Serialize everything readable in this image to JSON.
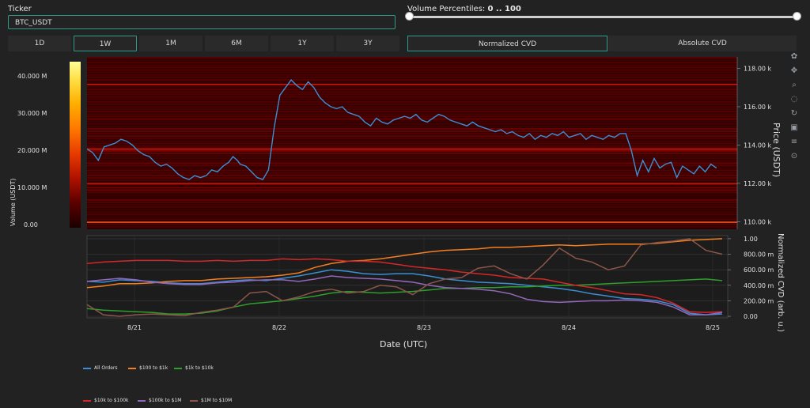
{
  "ticker": {
    "label": "Ticker",
    "value": "BTC_USDT"
  },
  "volume_percentiles": {
    "label": "Volume Percentiles:",
    "range_text": "0 .. 100",
    "low": 0,
    "high": 100
  },
  "timeframes": [
    {
      "label": "1D",
      "active": false
    },
    {
      "label": "1W",
      "active": true
    },
    {
      "label": "1M",
      "active": false
    },
    {
      "label": "6M",
      "active": false
    },
    {
      "label": "1Y",
      "active": false
    },
    {
      "label": "3Y",
      "active": false
    }
  ],
  "cvd_modes": [
    {
      "label": "Normalized CVD",
      "active": true
    },
    {
      "label": "Absolute CVD",
      "active": false
    }
  ],
  "toolbar_icons": [
    "plotly-logo-icon",
    "pan-icon",
    "zoom-icon",
    "lasso-icon",
    "reset-icon",
    "camera-icon",
    "compare-icon",
    "spike-icon"
  ],
  "colors": {
    "accent": "#2e9c88",
    "price_line": "#3a8fd6",
    "background": "#222222",
    "plot_bg": "#1a1a1a"
  },
  "chart_data": [
    {
      "type": "heatmap",
      "colorbar_label": "Volume (USDT)",
      "colorbar_ticks": [
        "40.000 M",
        "30.000 M",
        "20.000 M",
        "10.000 M",
        "0.00"
      ],
      "y_right_label": "Price (USDT)",
      "y_right_ticks": [
        "118.00 k",
        "116.00 k",
        "114.00 k",
        "112.00 k",
        "110.00 k"
      ],
      "ylim": [
        109.6,
        118.6
      ],
      "price_series": {
        "name": "Price",
        "x": [
          0,
          0.4,
          0.8,
          1.2,
          1.6,
          2.0,
          2.4,
          2.8,
          3.2,
          3.6,
          4.0,
          4.4,
          4.8,
          5.2,
          5.6,
          6.0,
          6.4,
          6.8,
          7.2,
          7.6,
          8.0,
          8.4,
          8.8,
          9.2,
          9.6,
          10.0,
          10.3,
          10.6,
          10.8,
          11.2,
          11.6,
          12.0,
          12.4,
          12.8,
          13.2,
          13.6,
          14.0,
          14.4,
          14.8,
          15.2,
          15.6,
          16.0,
          16.4,
          16.8,
          17.2,
          17.6,
          18.0,
          18.4,
          18.8,
          19.2,
          19.6,
          20.0,
          20.4,
          20.8,
          21.2,
          21.6,
          22.0,
          22.4,
          22.8,
          23.2,
          23.6,
          24.0,
          24.4,
          24.8,
          25.2,
          25.6,
          26.0,
          26.4,
          26.8,
          27.2,
          27.6,
          28.0,
          28.4,
          28.8,
          29.2,
          29.6,
          30.0,
          30.4,
          30.8,
          31.2,
          31.6,
          32.0,
          32.4,
          32.8,
          33.2,
          33.6,
          34.0,
          34.4,
          34.8,
          35.2,
          35.6,
          36.0,
          36.4,
          36.8,
          37.2,
          37.6,
          38.0,
          38.4,
          38.8,
          39.2,
          39.6,
          40.0,
          40.4,
          40.8,
          41.2,
          41.6,
          42.0,
          42.4,
          42.8,
          43.2,
          43.6,
          44.0,
          44.4,
          44.8
        ],
        "y": [
          113.8,
          113.6,
          113.2,
          113.9,
          114.0,
          114.1,
          114.3,
          114.2,
          114.0,
          113.7,
          113.5,
          113.4,
          113.1,
          112.9,
          113.0,
          112.8,
          112.5,
          112.3,
          112.2,
          112.4,
          112.3,
          112.4,
          112.7,
          112.6,
          112.9,
          113.1,
          113.4,
          113.2,
          113.0,
          112.9,
          112.6,
          112.3,
          112.2,
          112.7,
          114.9,
          116.6,
          117.0,
          117.4,
          117.1,
          116.9,
          117.3,
          117.0,
          116.5,
          116.2,
          116.0,
          115.9,
          116.0,
          115.7,
          115.6,
          115.5,
          115.2,
          115.0,
          115.4,
          115.2,
          115.1,
          115.3,
          115.4,
          115.5,
          115.4,
          115.6,
          115.3,
          115.2,
          115.4,
          115.6,
          115.5,
          115.3,
          115.2,
          115.1,
          115.0,
          115.2,
          115.0,
          114.9,
          114.8,
          114.7,
          114.8,
          114.6,
          114.7,
          114.5,
          114.4,
          114.6,
          114.3,
          114.5,
          114.4,
          114.6,
          114.5,
          114.7,
          114.4,
          114.5,
          114.6,
          114.3,
          114.5,
          114.4,
          114.3,
          114.5,
          114.4,
          114.6,
          114.6,
          113.7,
          112.4,
          113.2,
          112.6,
          113.3,
          112.8,
          113.0,
          113.1,
          112.3,
          112.9,
          112.7,
          112.5,
          112.9,
          112.6,
          113.0,
          112.8
        ]
      }
    },
    {
      "type": "line",
      "xlabel": "Date (UTC)",
      "ylabel": "Normalized CVD (arb. u.)",
      "x_ticks": [
        "8/21",
        "8/22",
        "8/23",
        "8/24",
        "8/25"
      ],
      "y_ticks": [
        "1.00",
        "800.00 m",
        "600.00 m",
        "400.00 m",
        "200.00 m",
        "0.00"
      ],
      "ylim": [
        -0.02,
        1.04
      ],
      "series": [
        {
          "name": "All Orders",
          "color": "#3a8fd6",
          "values": [
            0.45,
            0.44,
            0.47,
            0.46,
            0.45,
            0.43,
            0.42,
            0.42,
            0.44,
            0.46,
            0.47,
            0.46,
            0.49,
            0.52,
            0.56,
            0.6,
            0.58,
            0.55,
            0.54,
            0.55,
            0.55,
            0.52,
            0.48,
            0.46,
            0.44,
            0.43,
            0.42,
            0.4,
            0.38,
            0.36,
            0.33,
            0.29,
            0.26,
            0.23,
            0.22,
            0.2,
            0.15,
            0.04,
            0.02,
            0.03
          ]
        },
        {
          "name": "$100 to $1k",
          "color": "#f57f20",
          "values": [
            0.37,
            0.39,
            0.42,
            0.42,
            0.43,
            0.45,
            0.46,
            0.46,
            0.48,
            0.49,
            0.5,
            0.51,
            0.53,
            0.56,
            0.63,
            0.68,
            0.71,
            0.72,
            0.74,
            0.77,
            0.8,
            0.83,
            0.85,
            0.86,
            0.87,
            0.89,
            0.89,
            0.9,
            0.91,
            0.92,
            0.91,
            0.92,
            0.93,
            0.93,
            0.93,
            0.94,
            0.96,
            0.98,
            0.99,
            1.0
          ]
        },
        {
          "name": "$1k to $10k",
          "color": "#2ca02c",
          "values": [
            0.1,
            0.08,
            0.07,
            0.06,
            0.05,
            0.03,
            0.03,
            0.04,
            0.07,
            0.12,
            0.16,
            0.18,
            0.2,
            0.23,
            0.26,
            0.3,
            0.32,
            0.31,
            0.3,
            0.31,
            0.32,
            0.34,
            0.36,
            0.36,
            0.37,
            0.37,
            0.38,
            0.38,
            0.39,
            0.4,
            0.4,
            0.41,
            0.42,
            0.43,
            0.44,
            0.45,
            0.46,
            0.47,
            0.48,
            0.46
          ]
        },
        {
          "name": "$10k to $100k",
          "color": "#d62728",
          "values": [
            0.68,
            0.7,
            0.71,
            0.72,
            0.72,
            0.72,
            0.71,
            0.71,
            0.72,
            0.71,
            0.72,
            0.72,
            0.74,
            0.73,
            0.74,
            0.73,
            0.71,
            0.71,
            0.7,
            0.67,
            0.64,
            0.62,
            0.6,
            0.57,
            0.55,
            0.53,
            0.5,
            0.49,
            0.48,
            0.44,
            0.4,
            0.37,
            0.33,
            0.29,
            0.28,
            0.24,
            0.17,
            0.06,
            0.05,
            0.06
          ]
        },
        {
          "name": "$100k to $1M",
          "color": "#9467bd",
          "values": [
            0.45,
            0.47,
            0.49,
            0.47,
            0.44,
            0.42,
            0.41,
            0.41,
            0.43,
            0.44,
            0.46,
            0.47,
            0.47,
            0.45,
            0.48,
            0.52,
            0.5,
            0.49,
            0.48,
            0.46,
            0.44,
            0.4,
            0.37,
            0.36,
            0.35,
            0.33,
            0.29,
            0.22,
            0.19,
            0.18,
            0.19,
            0.2,
            0.2,
            0.21,
            0.2,
            0.18,
            0.12,
            0.02,
            0.02,
            0.05
          ]
        },
        {
          "name": "$1M to $10M",
          "color": "#8c564b",
          "values": [
            0.15,
            0.02,
            0.0,
            0.02,
            0.03,
            0.02,
            0.01,
            0.05,
            0.08,
            0.12,
            0.3,
            0.32,
            0.2,
            0.25,
            0.32,
            0.35,
            0.3,
            0.32,
            0.4,
            0.38,
            0.28,
            0.42,
            0.48,
            0.5,
            0.62,
            0.65,
            0.55,
            0.48,
            0.66,
            0.88,
            0.75,
            0.7,
            0.6,
            0.65,
            0.92,
            0.95,
            0.97,
            1.0,
            0.85,
            0.8
          ]
        }
      ]
    }
  ],
  "legend": [
    {
      "name": "All Orders",
      "color": "#3a8fd6"
    },
    {
      "name": "$100 to $1k",
      "color": "#f57f20"
    },
    {
      "name": "$1k to $10k",
      "color": "#2ca02c"
    },
    {
      "name": "$10k to $100k",
      "color": "#d62728"
    },
    {
      "name": "$100k to $1M",
      "color": "#9467bd"
    },
    {
      "name": "$1M to $10M",
      "color": "#8c564b"
    }
  ]
}
